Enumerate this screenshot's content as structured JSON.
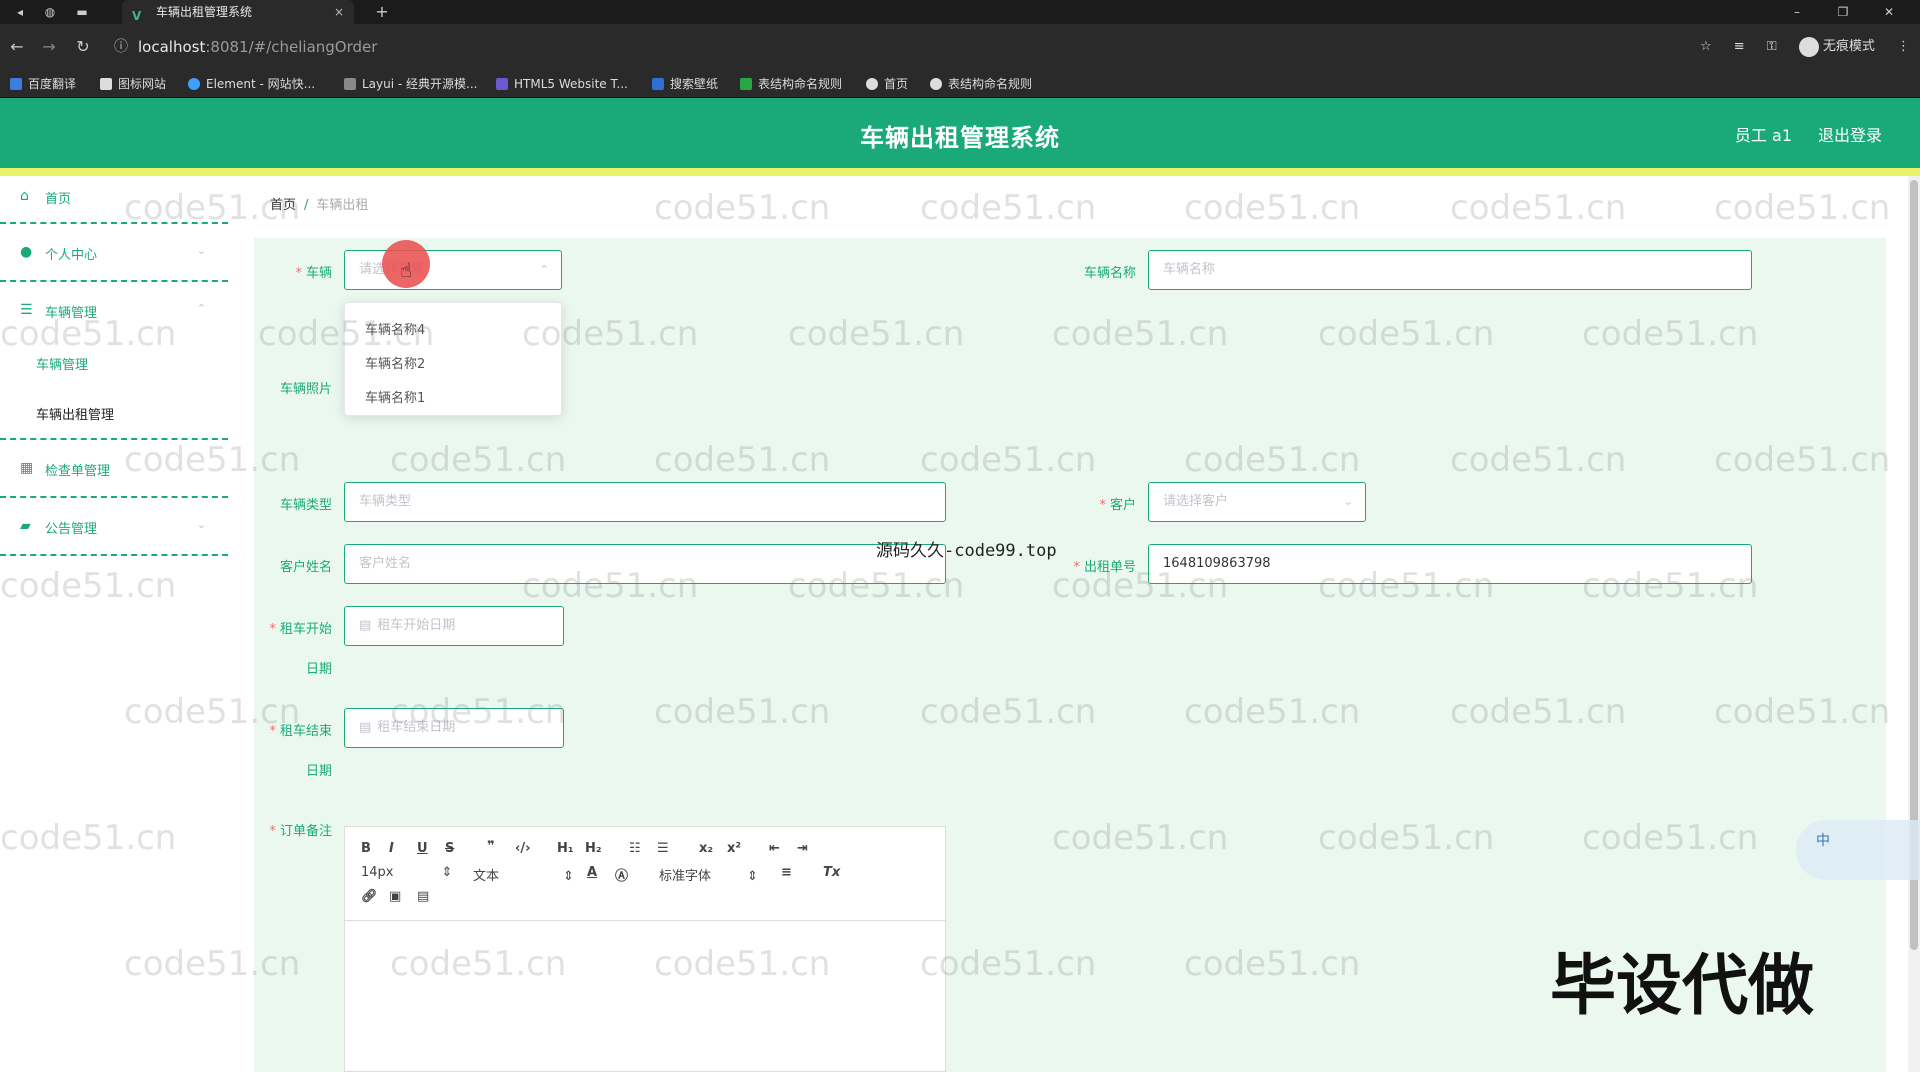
{
  "browser": {
    "tab_title": "车辆出租管理系统",
    "tab_close": "×",
    "new_tab": "+",
    "url_host": "localhost",
    "url_path": ":8081/#/cheliangOrder",
    "incognito_label": "无痕模式",
    "bookmarks": [
      "百度翻译",
      "图标网站",
      "Element - 网站快...",
      "Layui - 经典开源模...",
      "HTML5 Website T...",
      "搜索壁纸",
      "表结构命名规则",
      "首页",
      "表结构命名规则"
    ]
  },
  "header": {
    "title": "车辆出租管理系统",
    "user": "员工 a1",
    "logout": "退出登录"
  },
  "sidebar": {
    "home": "首页",
    "personal": "个人中心",
    "vehicle_mgmt": "车辆管理",
    "vehicle_sub": "车辆管理",
    "rental_sub": "车辆出租管理",
    "inspection": "检查单管理",
    "notice": "公告管理"
  },
  "breadcrumb": {
    "home": "首页",
    "sep": "/",
    "current": "车辆出租"
  },
  "form": {
    "vehicle_label": "车辆",
    "vehicle_placeholder": "请选择车辆",
    "vehicle_name_label": "车辆名称",
    "vehicle_name_placeholder": "车辆名称",
    "vehicle_photo_label": "车辆照片",
    "vehicle_type_label": "车辆类型",
    "vehicle_type_placeholder": "车辆类型",
    "customer_label": "客户",
    "customer_placeholder": "请选择客户",
    "customer_name_label": "客户姓名",
    "customer_name_placeholder": "客户姓名",
    "order_no_label": "出租单号",
    "order_no_value": "1648109863798",
    "start_label_1": "租车开始",
    "start_label_2": "日期",
    "start_placeholder": "租车开始日期",
    "end_label_1": "租车结束",
    "end_label_2": "日期",
    "end_placeholder": "租车结束日期",
    "remark_label": "订单备注"
  },
  "dropdown": {
    "options": [
      "车辆名称4",
      "车辆名称2",
      "车辆名称1"
    ]
  },
  "editor": {
    "font_size": "14px",
    "text_type": "文本",
    "font_family": "标准字体"
  },
  "overlays": {
    "watermark": "code51.cn",
    "promo": "源码久久-code99.top",
    "stamp": "毕设代做",
    "ime": "中"
  },
  "colors": {
    "primary": "#1aaa79",
    "stripe": "#e8f36a",
    "form_bg": "#eaf8f0",
    "required": "#f56c6c"
  }
}
